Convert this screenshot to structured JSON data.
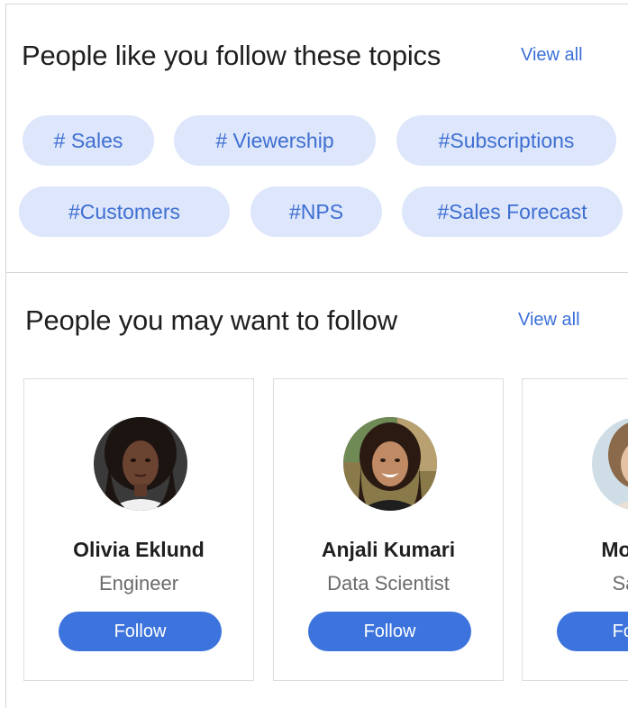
{
  "topics": {
    "title": "People like you follow these topics",
    "view_all": "View all",
    "chips": [
      {
        "label": "# Sales"
      },
      {
        "label": "# Viewership"
      },
      {
        "label": "#Subscriptions"
      },
      {
        "label": "#Customers"
      },
      {
        "label": "#NPS"
      },
      {
        "label": "#Sales Forecast"
      }
    ]
  },
  "people": {
    "title": "People you may want to follow",
    "view_all": "View all",
    "cards": [
      {
        "name": "Olivia Eklund",
        "role": "Engineer",
        "follow_label": "Follow"
      },
      {
        "name": "Anjali Kumari",
        "role": "Data Scientist",
        "follow_label": "Follow"
      },
      {
        "name": "Monika",
        "role": "Sales",
        "follow_label": "Follow"
      }
    ]
  },
  "colors": {
    "accent": "#3c73dc",
    "chip_bg": "#dde6fb",
    "chip_text": "#3e6fd1",
    "link": "#3a6fd8"
  }
}
